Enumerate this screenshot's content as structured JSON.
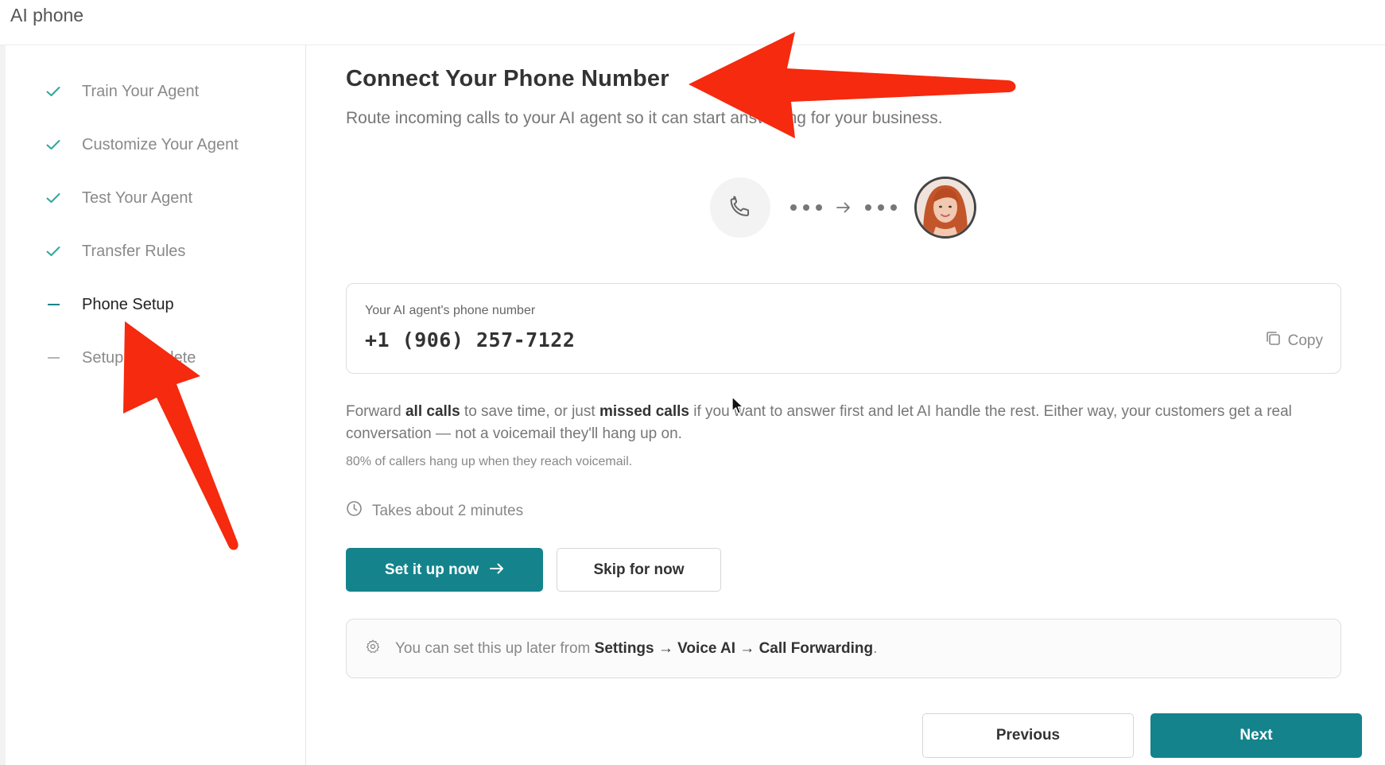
{
  "app": {
    "title": "AI phone"
  },
  "steps": [
    {
      "label": "Train Your Agent",
      "state": "done",
      "icon": "check-icon"
    },
    {
      "label": "Customize Your Agent",
      "state": "done",
      "icon": "check-icon"
    },
    {
      "label": "Test Your Agent",
      "state": "done",
      "icon": "check-icon"
    },
    {
      "label": "Transfer Rules",
      "state": "done",
      "icon": "check-icon"
    },
    {
      "label": "Phone Setup",
      "state": "current",
      "icon": "dash-icon"
    },
    {
      "label": "Setup Complete",
      "state": "pending",
      "icon": "dash-icon"
    }
  ],
  "main": {
    "title": "Connect Your Phone Number",
    "subtitle": "Route incoming calls to your AI agent so it can start answering for your business.",
    "phone_card": {
      "label": "Your AI agent's phone number",
      "number": "+1 (906) 257-7122",
      "copy_label": "Copy"
    },
    "description": {
      "part1": "Forward ",
      "bold1": "all calls",
      "part2": " to save time, or just ",
      "bold2": "missed calls",
      "part3": " if you want to answer first and let AI handle the rest. Either way, your customers get a real conversation — not a voicemail they'll hang up on."
    },
    "note": "80% of callers hang up when they reach voicemail.",
    "duration": "Takes about 2 minutes",
    "primary_button": "Set it up now",
    "secondary_button": "Skip for now",
    "info": {
      "prefix": "You can set this up later from ",
      "path": "Settings → Voice AI → Call Forwarding",
      "suffix": "."
    }
  },
  "footer": {
    "previous_label": "Previous",
    "next_label": "Next"
  },
  "colors": {
    "accent": "#14838c",
    "annotation": "#f52a0e"
  }
}
